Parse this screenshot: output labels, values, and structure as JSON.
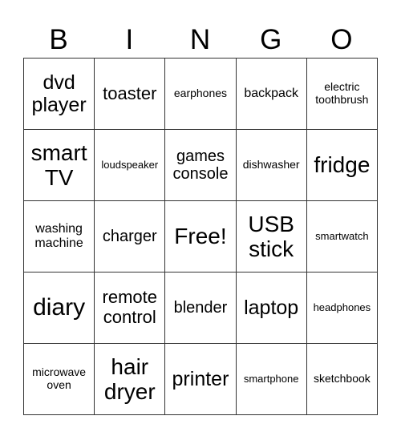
{
  "header": [
    "B",
    "I",
    "N",
    "G",
    "O"
  ],
  "rows": [
    [
      "dvd player",
      "toaster",
      "earphones",
      "backpack",
      "electric toothbrush"
    ],
    [
      "smart TV",
      "loudspeaker",
      "games console",
      "dishwasher",
      "fridge"
    ],
    [
      "washing machine",
      "charger",
      "Free!",
      "USB stick",
      "smartwatch"
    ],
    [
      "diary",
      "remote control",
      "blender",
      "laptop",
      "headphones"
    ],
    [
      "microwave oven",
      "hair dryer",
      "printer",
      "smartphone",
      "sketchbook"
    ]
  ]
}
